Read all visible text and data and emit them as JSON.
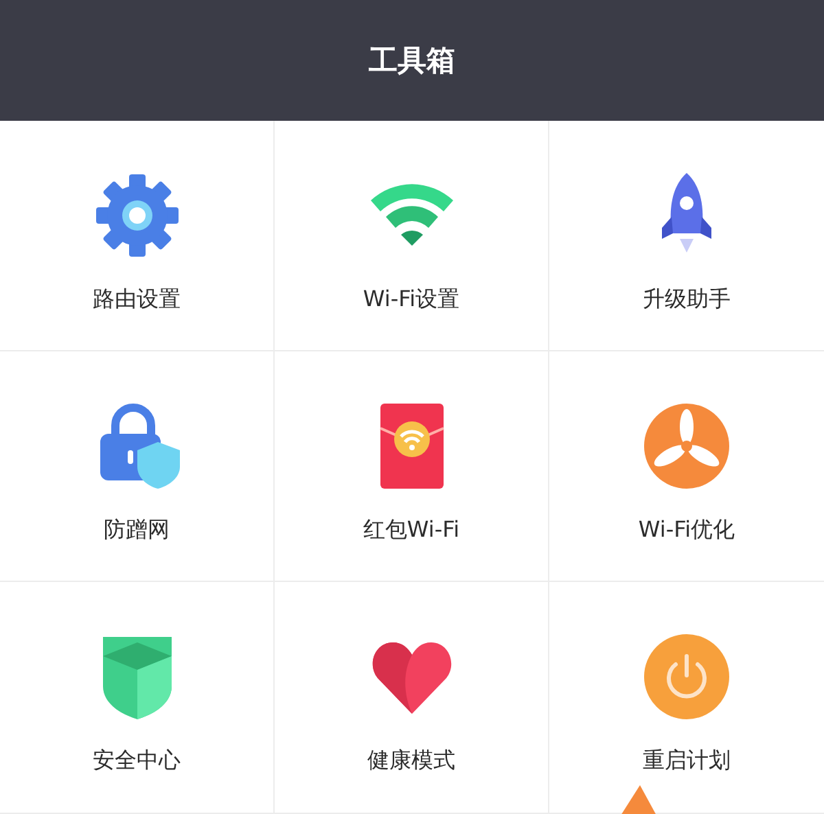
{
  "header": {
    "title": "工具箱"
  },
  "tools": [
    {
      "kind": "gear",
      "label": "路由设置"
    },
    {
      "kind": "wifi",
      "label": "Wi-Fi设置"
    },
    {
      "kind": "rocket",
      "label": "升级助手"
    },
    {
      "kind": "lock",
      "label": "防蹭网"
    },
    {
      "kind": "envelope",
      "label": "红包Wi-Fi"
    },
    {
      "kind": "fan",
      "label": "Wi-Fi优化"
    },
    {
      "kind": "shield",
      "label": "安全中心"
    },
    {
      "kind": "heart",
      "label": "健康模式"
    },
    {
      "kind": "power",
      "label": "重启计划"
    }
  ]
}
